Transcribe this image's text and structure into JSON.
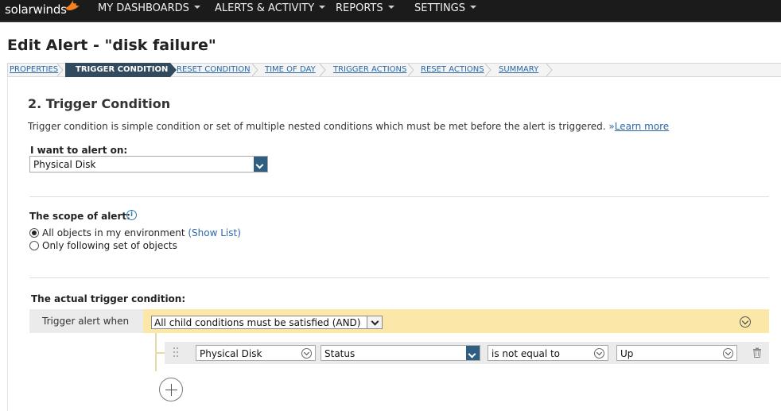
{
  "header": {
    "logo_text": "solarwinds",
    "nav": [
      {
        "label": "MY DASHBOARDS"
      },
      {
        "label": "ALERTS & ACTIVITY"
      },
      {
        "label": "REPORTS"
      },
      {
        "label": "SETTINGS"
      }
    ]
  },
  "page": {
    "title": "Edit Alert - \"disk failure\""
  },
  "wizard": {
    "steps": [
      {
        "label": "PROPERTIES"
      },
      {
        "label": "TRIGGER CONDITION",
        "active": true
      },
      {
        "label": "RESET CONDITION"
      },
      {
        "label": "TIME OF DAY"
      },
      {
        "label": "TRIGGER ACTIONS"
      },
      {
        "label": "RESET ACTIONS"
      },
      {
        "label": "SUMMARY"
      }
    ]
  },
  "section": {
    "title": "2. Trigger Condition",
    "description": "Trigger condition is simple condition or set of multiple nested conditions which must be met before the alert is triggered.",
    "learn_more_prefix": "»",
    "learn_more": "Learn more",
    "alert_on_label": "I want to alert on:",
    "alert_on_value": "Physical Disk",
    "scope_label": "The scope of alert:",
    "info_icon_glyph": "i",
    "scope_options": [
      {
        "label": "All objects in my environment",
        "link": "(Show List)",
        "checked": true
      },
      {
        "label": "Only following set of objects",
        "checked": false
      }
    ],
    "actual_trigger_label": "The actual trigger condition:",
    "trigger_when_label": "Trigger alert when",
    "group_operator": "All child conditions must be satisfied (AND)",
    "condition": {
      "object": "Physical Disk",
      "field": "Status",
      "operator": "is not equal to",
      "value": "Up"
    }
  },
  "colors": {
    "topbar": "#1b1b1b",
    "wizard_active": "#324a5e",
    "link": "#2a68a8",
    "group_highlight": "#fbe7a7",
    "logo_flame": "#f58220"
  },
  "icons": {
    "flame": "logo-flame-icon",
    "info": "info-icon",
    "dropdown": "chevron-down-icon",
    "drag": "drag-handle-icon",
    "trash": "trash-icon",
    "add": "plus-icon"
  }
}
